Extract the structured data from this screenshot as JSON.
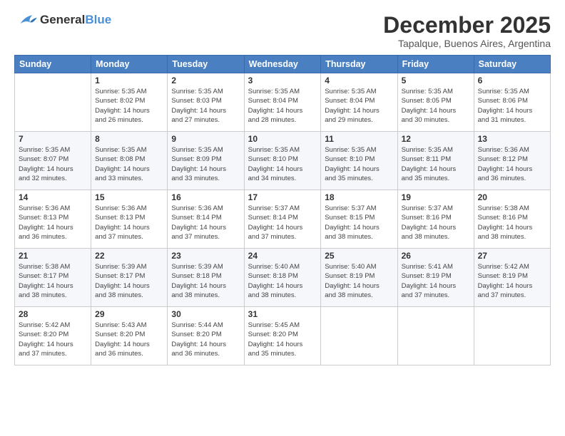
{
  "logo": {
    "general": "General",
    "blue": "Blue"
  },
  "title": "December 2025",
  "subtitle": "Tapalque, Buenos Aires, Argentina",
  "header_days": [
    "Sunday",
    "Monday",
    "Tuesday",
    "Wednesday",
    "Thursday",
    "Friday",
    "Saturday"
  ],
  "weeks": [
    [
      {
        "day": "",
        "sunrise": "",
        "sunset": "",
        "daylight": ""
      },
      {
        "day": "1",
        "sunrise": "Sunrise: 5:35 AM",
        "sunset": "Sunset: 8:02 PM",
        "daylight": "Daylight: 14 hours and 26 minutes."
      },
      {
        "day": "2",
        "sunrise": "Sunrise: 5:35 AM",
        "sunset": "Sunset: 8:03 PM",
        "daylight": "Daylight: 14 hours and 27 minutes."
      },
      {
        "day": "3",
        "sunrise": "Sunrise: 5:35 AM",
        "sunset": "Sunset: 8:04 PM",
        "daylight": "Daylight: 14 hours and 28 minutes."
      },
      {
        "day": "4",
        "sunrise": "Sunrise: 5:35 AM",
        "sunset": "Sunset: 8:04 PM",
        "daylight": "Daylight: 14 hours and 29 minutes."
      },
      {
        "day": "5",
        "sunrise": "Sunrise: 5:35 AM",
        "sunset": "Sunset: 8:05 PM",
        "daylight": "Daylight: 14 hours and 30 minutes."
      },
      {
        "day": "6",
        "sunrise": "Sunrise: 5:35 AM",
        "sunset": "Sunset: 8:06 PM",
        "daylight": "Daylight: 14 hours and 31 minutes."
      }
    ],
    [
      {
        "day": "7",
        "sunrise": "Sunrise: 5:35 AM",
        "sunset": "Sunset: 8:07 PM",
        "daylight": "Daylight: 14 hours and 32 minutes."
      },
      {
        "day": "8",
        "sunrise": "Sunrise: 5:35 AM",
        "sunset": "Sunset: 8:08 PM",
        "daylight": "Daylight: 14 hours and 33 minutes."
      },
      {
        "day": "9",
        "sunrise": "Sunrise: 5:35 AM",
        "sunset": "Sunset: 8:09 PM",
        "daylight": "Daylight: 14 hours and 33 minutes."
      },
      {
        "day": "10",
        "sunrise": "Sunrise: 5:35 AM",
        "sunset": "Sunset: 8:10 PM",
        "daylight": "Daylight: 14 hours and 34 minutes."
      },
      {
        "day": "11",
        "sunrise": "Sunrise: 5:35 AM",
        "sunset": "Sunset: 8:10 PM",
        "daylight": "Daylight: 14 hours and 35 minutes."
      },
      {
        "day": "12",
        "sunrise": "Sunrise: 5:35 AM",
        "sunset": "Sunset: 8:11 PM",
        "daylight": "Daylight: 14 hours and 35 minutes."
      },
      {
        "day": "13",
        "sunrise": "Sunrise: 5:36 AM",
        "sunset": "Sunset: 8:12 PM",
        "daylight": "Daylight: 14 hours and 36 minutes."
      }
    ],
    [
      {
        "day": "14",
        "sunrise": "Sunrise: 5:36 AM",
        "sunset": "Sunset: 8:13 PM",
        "daylight": "Daylight: 14 hours and 36 minutes."
      },
      {
        "day": "15",
        "sunrise": "Sunrise: 5:36 AM",
        "sunset": "Sunset: 8:13 PM",
        "daylight": "Daylight: 14 hours and 37 minutes."
      },
      {
        "day": "16",
        "sunrise": "Sunrise: 5:36 AM",
        "sunset": "Sunset: 8:14 PM",
        "daylight": "Daylight: 14 hours and 37 minutes."
      },
      {
        "day": "17",
        "sunrise": "Sunrise: 5:37 AM",
        "sunset": "Sunset: 8:14 PM",
        "daylight": "Daylight: 14 hours and 37 minutes."
      },
      {
        "day": "18",
        "sunrise": "Sunrise: 5:37 AM",
        "sunset": "Sunset: 8:15 PM",
        "daylight": "Daylight: 14 hours and 38 minutes."
      },
      {
        "day": "19",
        "sunrise": "Sunrise: 5:37 AM",
        "sunset": "Sunset: 8:16 PM",
        "daylight": "Daylight: 14 hours and 38 minutes."
      },
      {
        "day": "20",
        "sunrise": "Sunrise: 5:38 AM",
        "sunset": "Sunset: 8:16 PM",
        "daylight": "Daylight: 14 hours and 38 minutes."
      }
    ],
    [
      {
        "day": "21",
        "sunrise": "Sunrise: 5:38 AM",
        "sunset": "Sunset: 8:17 PM",
        "daylight": "Daylight: 14 hours and 38 minutes."
      },
      {
        "day": "22",
        "sunrise": "Sunrise: 5:39 AM",
        "sunset": "Sunset: 8:17 PM",
        "daylight": "Daylight: 14 hours and 38 minutes."
      },
      {
        "day": "23",
        "sunrise": "Sunrise: 5:39 AM",
        "sunset": "Sunset: 8:18 PM",
        "daylight": "Daylight: 14 hours and 38 minutes."
      },
      {
        "day": "24",
        "sunrise": "Sunrise: 5:40 AM",
        "sunset": "Sunset: 8:18 PM",
        "daylight": "Daylight: 14 hours and 38 minutes."
      },
      {
        "day": "25",
        "sunrise": "Sunrise: 5:40 AM",
        "sunset": "Sunset: 8:19 PM",
        "daylight": "Daylight: 14 hours and 38 minutes."
      },
      {
        "day": "26",
        "sunrise": "Sunrise: 5:41 AM",
        "sunset": "Sunset: 8:19 PM",
        "daylight": "Daylight: 14 hours and 37 minutes."
      },
      {
        "day": "27",
        "sunrise": "Sunrise: 5:42 AM",
        "sunset": "Sunset: 8:19 PM",
        "daylight": "Daylight: 14 hours and 37 minutes."
      }
    ],
    [
      {
        "day": "28",
        "sunrise": "Sunrise: 5:42 AM",
        "sunset": "Sunset: 8:20 PM",
        "daylight": "Daylight: 14 hours and 37 minutes."
      },
      {
        "day": "29",
        "sunrise": "Sunrise: 5:43 AM",
        "sunset": "Sunset: 8:20 PM",
        "daylight": "Daylight: 14 hours and 36 minutes."
      },
      {
        "day": "30",
        "sunrise": "Sunrise: 5:44 AM",
        "sunset": "Sunset: 8:20 PM",
        "daylight": "Daylight: 14 hours and 36 minutes."
      },
      {
        "day": "31",
        "sunrise": "Sunrise: 5:45 AM",
        "sunset": "Sunset: 8:20 PM",
        "daylight": "Daylight: 14 hours and 35 minutes."
      },
      {
        "day": "",
        "sunrise": "",
        "sunset": "",
        "daylight": ""
      },
      {
        "day": "",
        "sunrise": "",
        "sunset": "",
        "daylight": ""
      },
      {
        "day": "",
        "sunrise": "",
        "sunset": "",
        "daylight": ""
      }
    ]
  ]
}
